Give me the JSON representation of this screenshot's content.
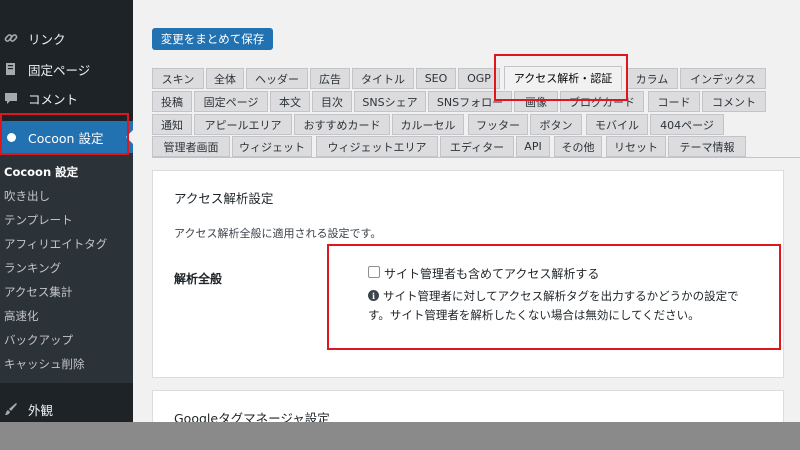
{
  "sidebar": {
    "top_items": [
      {
        "label": "リンク",
        "icon": "link-icon"
      },
      {
        "label": "固定ページ",
        "icon": "page-icon"
      },
      {
        "label": "コメント",
        "icon": "comment-icon"
      }
    ],
    "cocoon_label": "Cocoon 設定",
    "submenu": [
      "Cocoon 設定",
      "吹き出し",
      "テンプレート",
      "アフィリエイトタグ",
      "ランキング",
      "アクセス集計",
      "高速化",
      "バックアップ",
      "キャッシュ削除"
    ],
    "appearance_label": "外観"
  },
  "toolbar": {
    "save_label": "変更をまとめて保存"
  },
  "tabs": {
    "row1": [
      "スキン",
      "全体",
      "ヘッダー",
      "広告",
      "タイトル",
      "SEO",
      "OGP",
      "アクセス解析・認証",
      "カラム",
      "インデックス"
    ],
    "row2": [
      "投稿",
      "固定ページ",
      "本文",
      "目次",
      "SNSシェア",
      "SNSフォロー",
      "画像",
      "ブログカード",
      "コード",
      "コメント"
    ],
    "row3": [
      "通知",
      "アピールエリア",
      "おすすめカード",
      "カルーセル",
      "フッター",
      "ボタン",
      "モバイル",
      "404ページ"
    ],
    "row4": [
      "管理者画面",
      "ウィジェット",
      "ウィジェットエリア",
      "エディター",
      "API",
      "その他",
      "リセット",
      "テーマ情報"
    ],
    "active": "アクセス解析・認証"
  },
  "section": {
    "title": "アクセス解析設定",
    "description": "アクセス解析全般に適用される設定です。",
    "field_label": "解析全般",
    "checkbox_label": "サイト管理者も含めてアクセス解析する",
    "checkbox_checked": false,
    "help_line1": "サイト管理者に対してアクセス解析タグを出力するかどうかの設定で",
    "help_line2": "す。サイト管理者を解析したくない場合は無効にしてください。"
  },
  "section2": {
    "title": "Googleタグマネージャ設定"
  },
  "colors": {
    "sidebar_bg": "#1d2327",
    "accent": "#2271b1",
    "highlight_box": "#e0161e"
  }
}
